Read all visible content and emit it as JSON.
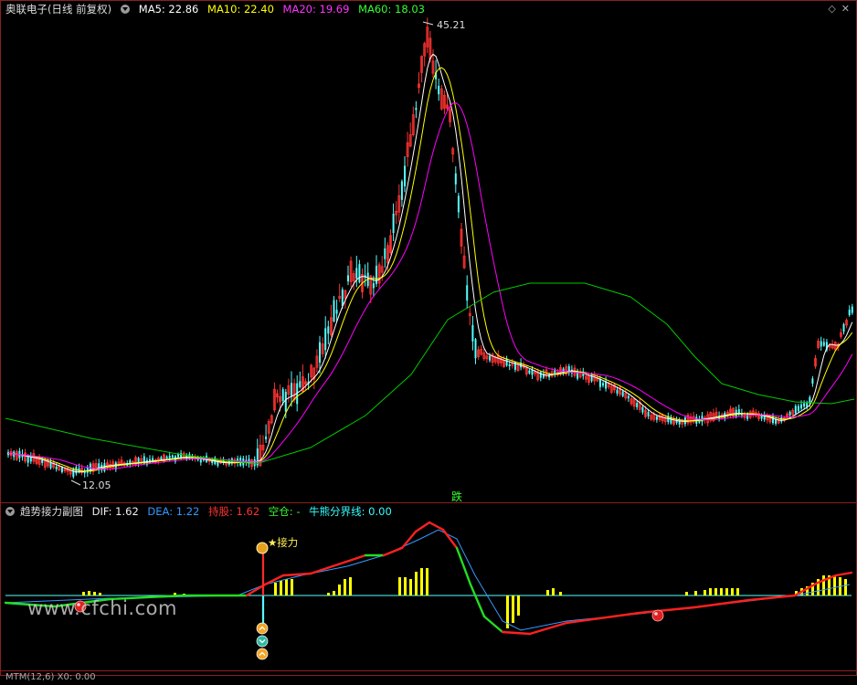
{
  "main_panel": {
    "stock_name": "奥联电子",
    "period": "(日线 前复权)",
    "ma": [
      {
        "label": "MA5: 22.86",
        "color": "#ffffff"
      },
      {
        "label": "MA10: 22.40",
        "color": "#ffff00"
      },
      {
        "label": "MA20: 19.69",
        "color": "#ff00ff"
      },
      {
        "label": "MA60: 18.03",
        "color": "#00ff00"
      }
    ],
    "high_label": "45.21",
    "low_label": "12.05",
    "signal_text": "跌"
  },
  "sub_panel": {
    "name": "趋势接力副图",
    "dif": "DIF: 1.62",
    "dea": "DEA: 1.22",
    "hold": "持股: 1.62",
    "empty": "空仓: -",
    "bull_bear": "牛熊分界线: 0.00",
    "relay_label": "★接力"
  },
  "bottom_panel": {
    "label": "MTM(12,6)  X0: 0.00"
  },
  "watermark": "www.cfchi.com",
  "colors": {
    "bg": "#000000",
    "up": "#ff3232",
    "down": "#54ffff",
    "ma5": "#ffffff",
    "ma10": "#ffff00",
    "ma20": "#ff00ff",
    "ma60": "#00c800",
    "zero_line": "#54ffff"
  }
}
